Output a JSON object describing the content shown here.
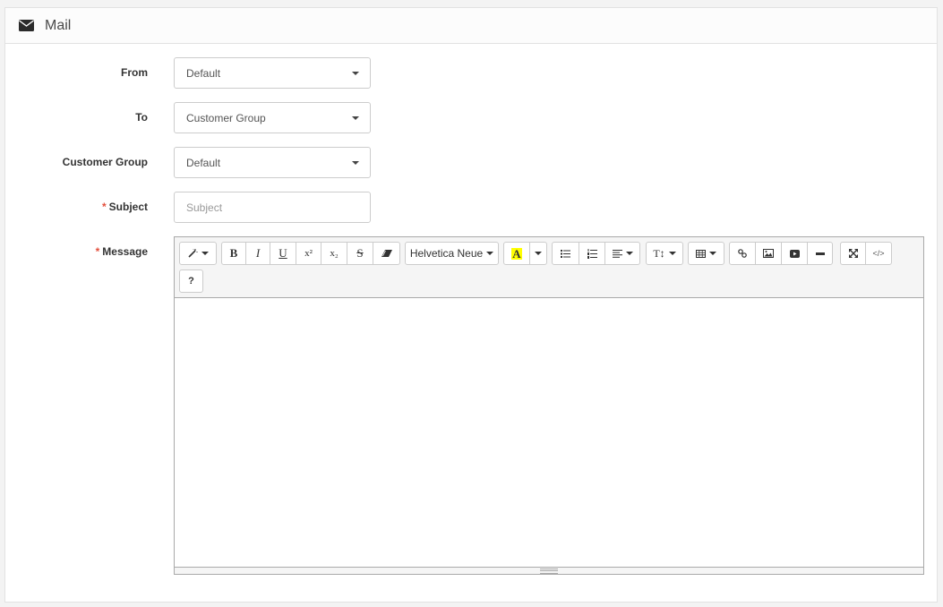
{
  "panel": {
    "title": "Mail",
    "icon": "envelope-icon"
  },
  "form": {
    "from": {
      "label": "From",
      "value": "Default",
      "required": false
    },
    "to": {
      "label": "To",
      "value": "Customer Group",
      "required": false
    },
    "customer_group": {
      "label": "Customer Group",
      "value": "Default",
      "required": false
    },
    "subject": {
      "label": "Subject",
      "value": "",
      "placeholder": "Subject",
      "required": true,
      "required_mark": "*"
    },
    "message": {
      "label": "Message",
      "value": "",
      "required": true,
      "required_mark": "*"
    }
  },
  "editor": {
    "toolbar": {
      "style": {
        "icon": "magic-wand-icon"
      },
      "font": {
        "bold": "B",
        "italic": "I",
        "underline": "U",
        "superscript": "x²",
        "subscript": "x₂",
        "strikethrough": "S",
        "clear": "eraser-icon"
      },
      "font_name": "Helvetica Neue",
      "color": {
        "label": "A",
        "highlight": "#ffff00"
      },
      "para": [
        "unordered-list-icon",
        "ordered-list-icon",
        "align-left-icon"
      ],
      "height": "T↕",
      "table": "table-icon",
      "insert": [
        "link-icon",
        "picture-icon",
        "video-icon",
        "horizontal-rule-icon"
      ],
      "view": [
        "fullscreen-icon",
        "code-view-icon"
      ],
      "help": "?"
    }
  }
}
